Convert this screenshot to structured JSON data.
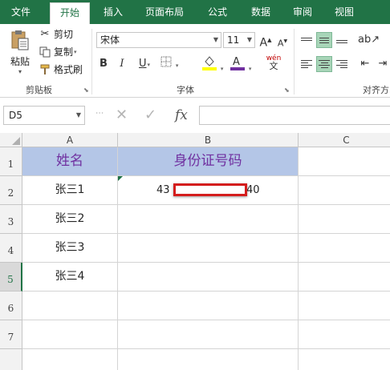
{
  "tabs": [
    {
      "label": "文件",
      "active": false
    },
    {
      "label": "开始",
      "active": true
    },
    {
      "label": "插入",
      "active": false
    },
    {
      "label": "页面布局",
      "active": false
    },
    {
      "label": "公式",
      "active": false
    },
    {
      "label": "数据",
      "active": false
    },
    {
      "label": "审阅",
      "active": false
    },
    {
      "label": "视图",
      "active": false
    }
  ],
  "clipboard": {
    "paste_label": "粘贴",
    "cut_label": "剪切",
    "copy_label": "复制",
    "format_painter_label": "格式刷",
    "group_label": "剪贴板"
  },
  "font": {
    "font_name": "宋体",
    "font_size": "11",
    "grow_label": "A",
    "shrink_label": "A",
    "bold_label": "B",
    "italic_label": "I",
    "underline_label": "U",
    "wen_label": "wén",
    "wen_sub_label": "文",
    "group_label": "字体"
  },
  "alignment": {
    "group_label": "对齐方"
  },
  "formula_bar": {
    "name_box": "D5",
    "fx_label": "fx",
    "formula": ""
  },
  "grid": {
    "columns": [
      "A",
      "B",
      "C"
    ],
    "rows": [
      "1",
      "2",
      "3",
      "4",
      "5",
      "6",
      "7"
    ],
    "selected_row": "5",
    "header_row": {
      "name": "姓名",
      "id": "身份证号码"
    },
    "data_rows": [
      {
        "name": "张三1",
        "id_start": "43",
        "id_end": "40"
      },
      {
        "name": "张三2",
        "id_start": "",
        "id_end": ""
      },
      {
        "name": "张三3",
        "id_start": "",
        "id_end": ""
      },
      {
        "name": "张三4",
        "id_start": "",
        "id_end": ""
      }
    ]
  },
  "colors": {
    "accent": "#217346",
    "header_fill": "#b4c6e7",
    "header_text": "#7030a0",
    "redaction_border": "#d41d1d",
    "font_color_bar": "#7030a0",
    "fill_color_bar": "#ffff00"
  },
  "icons": [
    "cut-icon",
    "copy-icon",
    "format-painter-icon",
    "paste-icon",
    "fill-color-icon",
    "font-color-icon",
    "border-icon",
    "cancel-icon",
    "confirm-icon",
    "insert-function-icon"
  ]
}
